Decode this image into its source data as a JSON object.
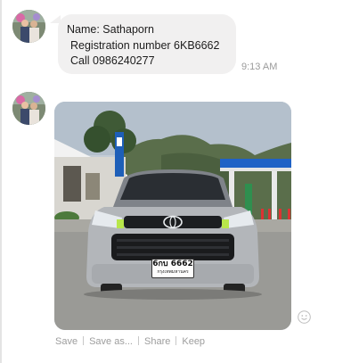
{
  "message": {
    "line1": "Name: Sathaporn",
    "line2": "Registration number 6KB6662",
    "line3": "Call 0986240277",
    "time": "9:13 AM"
  },
  "photo": {
    "plate_number": "6กบ 6662",
    "plate_province": "กรุงเทพมหานคร"
  },
  "actions": {
    "save": "Save",
    "save_as": "Save as...",
    "share": "Share",
    "keep": "Keep"
  },
  "icons": {
    "emoji": "smiley-icon",
    "avatar": "profile-photo"
  },
  "colors": {
    "bubble": "#f1f0f0",
    "timestamp": "#9b9b9b",
    "action_text": "#9d9d9d"
  }
}
